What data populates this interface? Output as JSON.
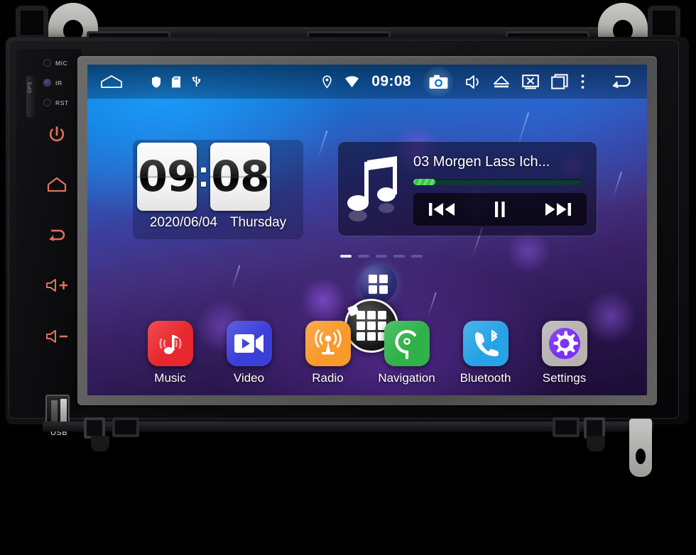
{
  "device": {
    "left_panel": {
      "gps_label": "GPS",
      "indicators": [
        {
          "name": "MIC",
          "label": "MIC"
        },
        {
          "name": "IR",
          "label": "IR"
        },
        {
          "name": "RST",
          "label": "RST"
        }
      ],
      "buttons": [
        {
          "name": "power",
          "icon": "power-icon"
        },
        {
          "name": "home",
          "icon": "home-icon"
        },
        {
          "name": "back",
          "icon": "back-arrow-icon"
        },
        {
          "name": "volume-up",
          "icon": "volume-up-icon"
        },
        {
          "name": "volume-down",
          "icon": "volume-down-icon"
        }
      ],
      "usb_label": "USB"
    },
    "colors": {
      "button_accent": "#e2725b",
      "bezel": "#5c5c5c",
      "body": "#141417"
    }
  },
  "screen": {
    "statusbar": {
      "home_icon": "home-outline-icon",
      "system_icons": [
        "shield-icon",
        "sd-card-icon",
        "usb-icon"
      ],
      "location_icon": "location-pin-icon",
      "wifi_icon": "wifi-icon",
      "time": "09:08",
      "camera_icon": "camera-icon",
      "mute_icon": "speaker-mute-icon",
      "eject_icon": "eject-icon",
      "screen_off_icon": "screen-off-icon",
      "recents_icon": "recent-apps-icon",
      "overflow_icon": "more-vertical-icon",
      "back_icon": "back-arrow-icon"
    },
    "clock_widget": {
      "hours": "09",
      "minutes": "08",
      "date": "2020/06/04",
      "weekday": "Thursday"
    },
    "music_widget": {
      "note_icon": "music-note-icon",
      "track_title": "03 Morgen Lass Ich...",
      "progress_percent": 13,
      "progress_color": "#4ecd55",
      "controls": [
        {
          "name": "previous-track",
          "icon": "skip-previous-icon"
        },
        {
          "name": "pause",
          "icon": "pause-icon"
        },
        {
          "name": "next-track",
          "icon": "skip-next-icon"
        }
      ]
    },
    "page_indicator": {
      "total": 5,
      "active": 1
    },
    "drawer_small": {
      "icon": "grid-4-icon"
    },
    "drawer_big": {
      "icon": "app-drawer-icon"
    },
    "dock": [
      {
        "label": "Music",
        "icon": "music-app-icon",
        "color": "#e8282e"
      },
      {
        "label": "Video",
        "icon": "video-app-icon",
        "color": "#3b3fd8"
      },
      {
        "label": "Radio",
        "icon": "radio-app-icon",
        "color": "#f79a2b"
      },
      {
        "label": "Navigation",
        "icon": "navigation-app-icon",
        "color": "#2fb24a"
      },
      {
        "label": "Bluetooth",
        "icon": "bluetooth-app-icon",
        "color": "#27a3e5"
      },
      {
        "label": "Settings",
        "icon": "settings-app-icon",
        "color": "#b7b3b3"
      }
    ]
  }
}
